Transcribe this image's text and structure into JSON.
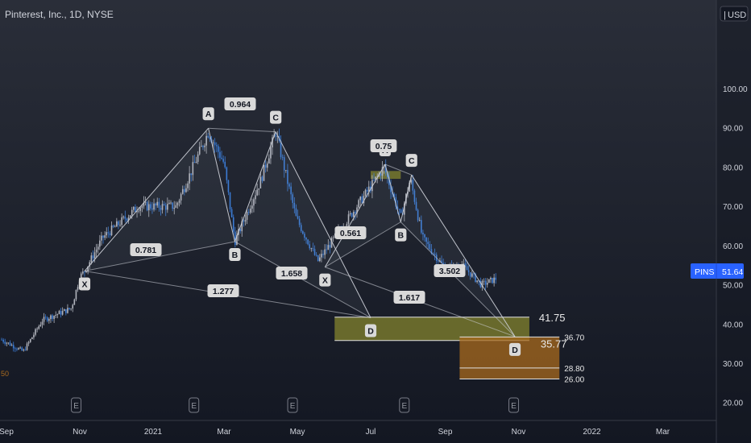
{
  "header": {
    "title": "Pinterest, Inc., 1D, NYSE",
    "currency_label": "USD",
    "currency_icon": "chevron-down-icon",
    "left_edge_label": "50"
  },
  "colors": {
    "background_top": "#2a2e39",
    "background_bottom": "#131722",
    "up_candle": "#b2b5be",
    "down_candle": "#3b7bd4",
    "pattern_line": "#d1d4dc",
    "zone_olive": "#8a8a2e",
    "zone_orange": "#a86a1e",
    "price_badge": "#2962ff",
    "axis_text": "#d1d4dc"
  },
  "chart_data": {
    "type": "candlestick",
    "symbol": "PINS",
    "last_price": "51.64",
    "x_axis_ticks": [
      "Sep",
      "Nov",
      "2021",
      "Mar",
      "May",
      "Jul",
      "Sep",
      "Nov",
      "2022",
      "Mar"
    ],
    "y_axis_ticks": [
      "20.00",
      "30.00",
      "40.00",
      "50.00",
      "60.00",
      "70.00",
      "80.00",
      "90.00",
      "100.00"
    ],
    "ylim": [
      18.3,
      107.8
    ],
    "price_path_approx": [
      {
        "date": "2020-08-28",
        "price": 36
      },
      {
        "date": "2020-09-15",
        "price": 33
      },
      {
        "date": "2020-10-01",
        "price": 41
      },
      {
        "date": "2020-10-25",
        "price": 44
      },
      {
        "date": "2020-11-01",
        "price": 52
      },
      {
        "date": "2020-11-05",
        "price": 53.5
      },
      {
        "date": "2020-11-20",
        "price": 62
      },
      {
        "date": "2020-12-20",
        "price": 70
      },
      {
        "date": "2021-01-20",
        "price": 70
      },
      {
        "date": "2021-02-16",
        "price": 89
      },
      {
        "date": "2021-03-01",
        "price": 81
      },
      {
        "date": "2021-03-10",
        "price": 61
      },
      {
        "date": "2021-04-01",
        "price": 77
      },
      {
        "date": "2021-04-13",
        "price": 89
      },
      {
        "date": "2021-04-30",
        "price": 67
      },
      {
        "date": "2021-05-18",
        "price": 56
      },
      {
        "date": "2021-06-01",
        "price": 62
      },
      {
        "date": "2021-07-01",
        "price": 75
      },
      {
        "date": "2021-07-12",
        "price": 80
      },
      {
        "date": "2021-07-26",
        "price": 67
      },
      {
        "date": "2021-08-03",
        "price": 77
      },
      {
        "date": "2021-08-13",
        "price": 62
      },
      {
        "date": "2021-09-01",
        "price": 54
      },
      {
        "date": "2021-09-15",
        "price": 55
      },
      {
        "date": "2021-10-01",
        "price": 50
      },
      {
        "date": "2021-10-14",
        "price": 51.64
      }
    ],
    "harmonic_patterns": [
      {
        "points": [
          {
            "label": "X",
            "date": "2020-11-05",
            "price": 53.5
          },
          {
            "label": "A",
            "date": "2021-02-16",
            "price": 89.9
          },
          {
            "label": "B",
            "date": "2021-03-10",
            "price": 61
          },
          {
            "label": "C",
            "date": "2021-04-13",
            "price": 89
          },
          {
            "label": "D",
            "date": "2021-07-01",
            "price": 41.6
          }
        ],
        "ratios": [
          "0.781",
          "0.964",
          "1.658",
          "1.277"
        ]
      },
      {
        "points": [
          {
            "label": "X",
            "date": "2021-05-24",
            "price": 54.5
          },
          {
            "label": "A",
            "date": "2021-07-13",
            "price": 80.7
          },
          {
            "label": "B",
            "date": "2021-07-26",
            "price": 66
          },
          {
            "label": "C",
            "date": "2021-08-04",
            "price": 78
          },
          {
            "label": "D",
            "date": "2021-10-29",
            "price": 36.8
          }
        ],
        "ratios": [
          "0.561",
          "0.75",
          "3.502",
          "1.617"
        ]
      }
    ],
    "zones": [
      {
        "name": "olive-band-top",
        "from": "2021-07-01",
        "to": "2021-07-26",
        "low": 77,
        "high": 79
      },
      {
        "name": "d-zone-1",
        "from": "2021-06-01",
        "to": "2021-11-10",
        "low": 35.8,
        "high": 41.75,
        "label": "41.75",
        "sublabel": "35.77"
      },
      {
        "name": "d-zone-2",
        "from": "2021-09-13",
        "to": "2021-12-05",
        "low": 26,
        "high": 36.7,
        "levels": [
          "36.70",
          "28.80",
          "26.00"
        ]
      }
    ],
    "earnings_markers_dates": [
      "2020-10-29",
      "2021-02-04",
      "2021-04-27",
      "2021-07-29",
      "2021-10-28"
    ],
    "earnings_label": "E"
  }
}
